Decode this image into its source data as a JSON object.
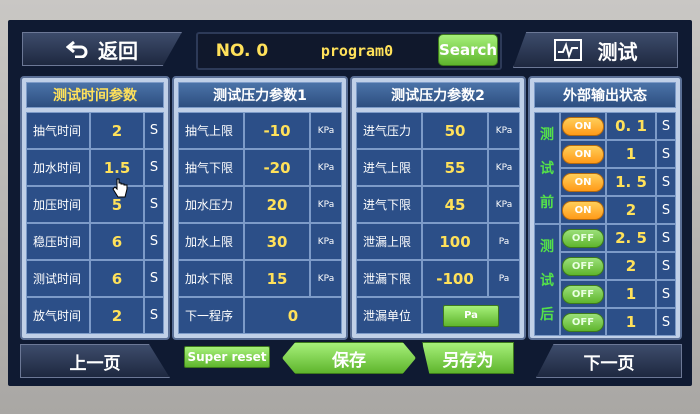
{
  "header": {
    "back_label": "返回",
    "no_label": "NO. 0",
    "program_name": "program0",
    "search_label": "Search",
    "test_label": "测试"
  },
  "time_params": {
    "title": "测试时间参数",
    "rows": [
      {
        "label": "抽气时间",
        "value": "2",
        "unit": "S"
      },
      {
        "label": "加水时间",
        "value": "1.5",
        "unit": "S"
      },
      {
        "label": "加压时间",
        "value": "5",
        "unit": "S"
      },
      {
        "label": "稳压时间",
        "value": "6",
        "unit": "S"
      },
      {
        "label": "测试时间",
        "value": "6",
        "unit": "S"
      },
      {
        "label": "放气时间",
        "value": "2",
        "unit": "S"
      }
    ]
  },
  "pressure_params1": {
    "title": "测试压力参数1",
    "rows": [
      {
        "label": "抽气上限",
        "value": "-10",
        "unit": "KPa"
      },
      {
        "label": "抽气下限",
        "value": "-20",
        "unit": "KPa"
      },
      {
        "label": "加水压力",
        "value": "20",
        "unit": "KPa"
      },
      {
        "label": "加水上限",
        "value": "30",
        "unit": "KPa"
      },
      {
        "label": "加水下限",
        "value": "15",
        "unit": "KPa"
      },
      {
        "label": "下一程序",
        "value": "0",
        "unit": ""
      }
    ]
  },
  "pressure_params2": {
    "title": "测试压力参数2",
    "rows": [
      {
        "label": "进气压力",
        "value": "50",
        "unit": "KPa"
      },
      {
        "label": "进气上限",
        "value": "55",
        "unit": "KPa"
      },
      {
        "label": "进气下限",
        "value": "45",
        "unit": "KPa"
      },
      {
        "label": "泄漏上限",
        "value": "100",
        "unit": "Pa"
      },
      {
        "label": "泄漏下限",
        "value": "-100",
        "unit": "Pa"
      },
      {
        "label": "泄漏单位",
        "value": "Pa",
        "unit": ""
      }
    ]
  },
  "output_status": {
    "title": "外部输出状态",
    "before_label": [
      "测",
      "试",
      "前"
    ],
    "after_label": [
      "测",
      "试",
      "后"
    ],
    "rows": [
      {
        "state": "ON",
        "value": "0. 1",
        "unit": "S"
      },
      {
        "state": "ON",
        "value": "1",
        "unit": "S"
      },
      {
        "state": "ON",
        "value": "1. 5",
        "unit": "S"
      },
      {
        "state": "ON",
        "value": "2",
        "unit": "S"
      },
      {
        "state": "OFF",
        "value": "2. 5",
        "unit": "S"
      },
      {
        "state": "OFF",
        "value": "2",
        "unit": "S"
      },
      {
        "state": "OFF",
        "value": "1",
        "unit": "S"
      },
      {
        "state": "OFF",
        "value": "1",
        "unit": "S"
      }
    ]
  },
  "footer": {
    "prev_label": "上一页",
    "super_reset_label": "Super reset",
    "save_label": "保存",
    "save_as_label": "另存为",
    "next_label": "下一页"
  },
  "colors": {
    "value_yellow": "#ffe15a",
    "on_orange": "#ff9a18",
    "off_green": "#5fb52d",
    "panel_blue": "#2c4f88"
  }
}
